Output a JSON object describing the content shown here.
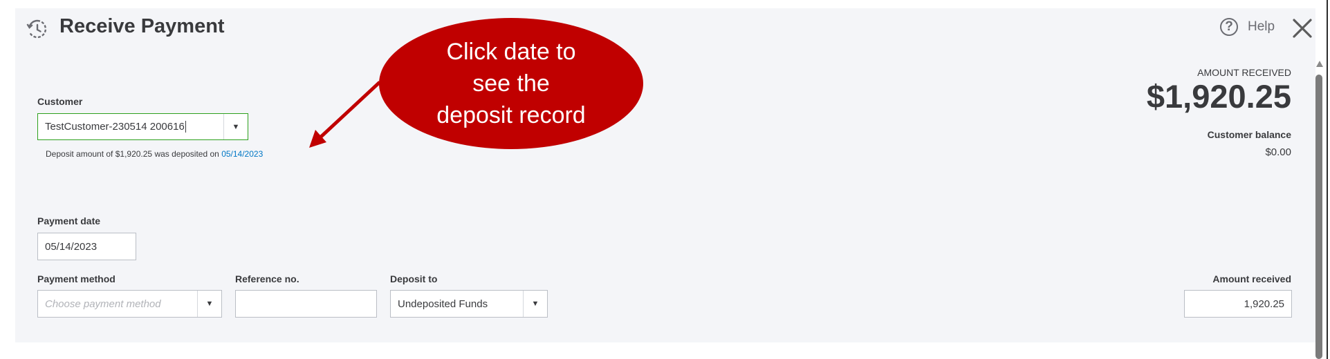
{
  "header": {
    "title": "Receive Payment",
    "help_label": "Help",
    "icons": [
      "history-icon",
      "help-icon",
      "close-icon"
    ]
  },
  "customer": {
    "label": "Customer",
    "value": "TestCustomer-230514 200616",
    "deposit_note_prefix": "Deposit amount of $1,920.25 was deposited on ",
    "deposit_date_link": "05/14/2023"
  },
  "payment_date": {
    "label": "Payment date",
    "value": "05/14/2023"
  },
  "payment_method": {
    "label": "Payment method",
    "placeholder": "Choose payment method"
  },
  "reference": {
    "label": "Reference no.",
    "value": ""
  },
  "deposit_to": {
    "label": "Deposit to",
    "value": "Undeposited Funds"
  },
  "summary": {
    "amount_received_caption": "AMOUNT RECEIVED",
    "amount_received_value": "$1,920.25",
    "customer_balance_label": "Customer balance",
    "customer_balance_value": "$0.00"
  },
  "amount_received_field": {
    "label": "Amount received",
    "value": "1,920.25"
  },
  "callout": {
    "text": "Click date to\nsee the\ndeposit record"
  },
  "colors": {
    "accent_green": "#2ca01c",
    "link_blue": "#0077c5",
    "callout_red": "#c00000",
    "panel_bg": "#f4f5f8"
  }
}
